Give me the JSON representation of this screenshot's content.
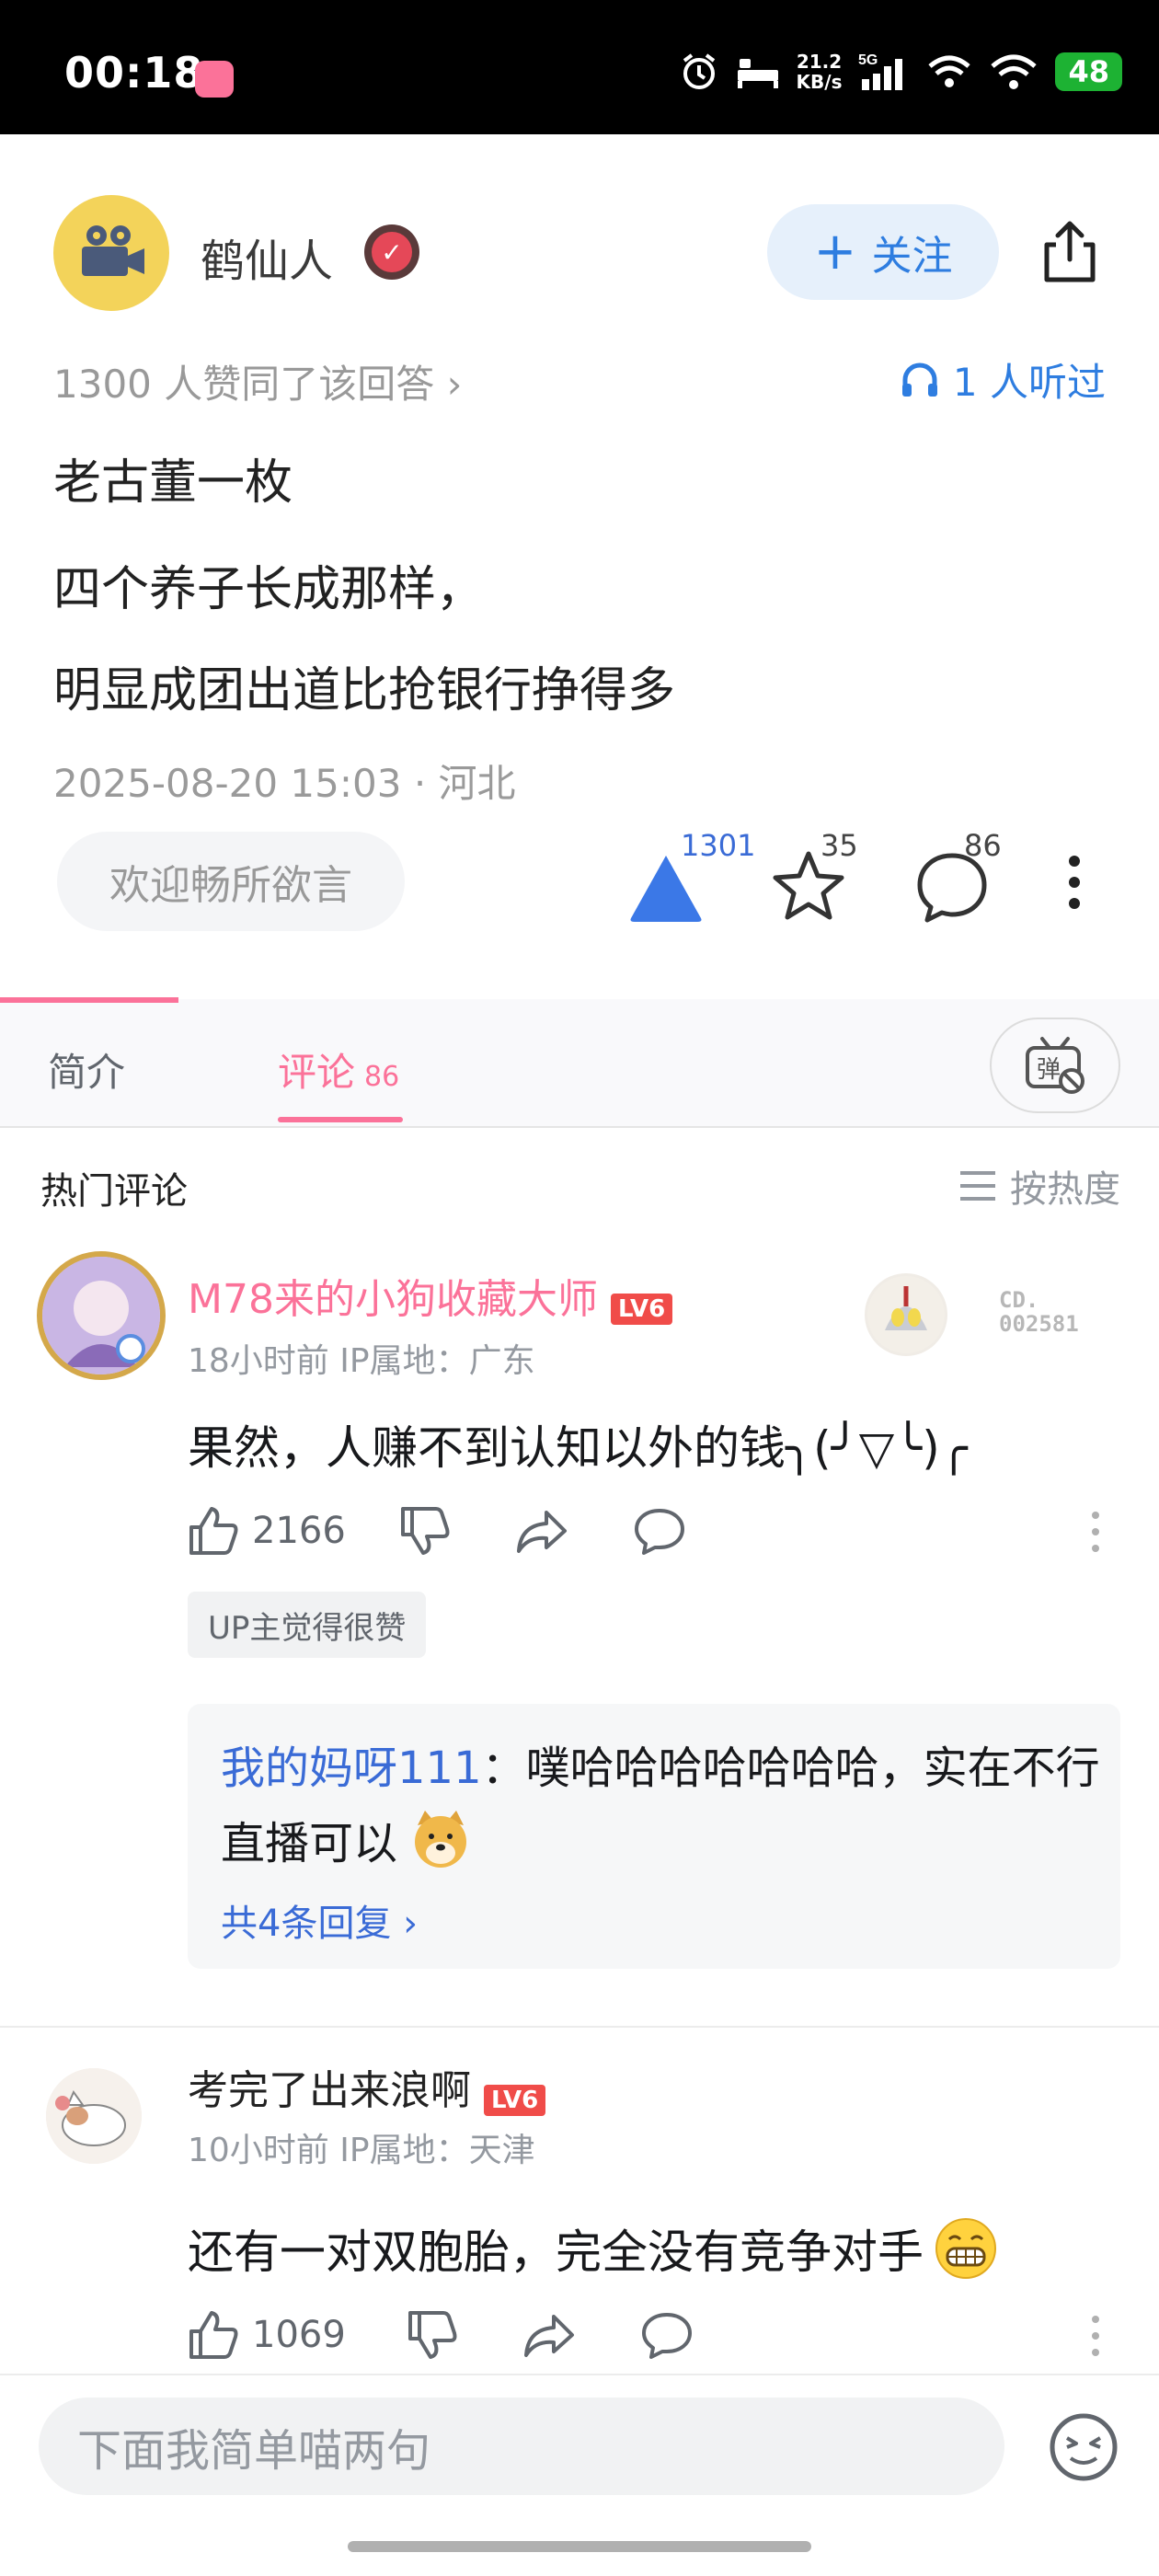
{
  "status_bar": {
    "time": "00:18",
    "net_speed": "21.2",
    "net_unit": "KB/s",
    "network": "5G",
    "battery": "48"
  },
  "answer": {
    "author": "鹤仙人",
    "follow_label": "关注",
    "agree_text": "1300 人赞同了该回答 ›",
    "listened_text": "1 人听过",
    "lines": [
      "老古董一枚",
      "四个养子长成那样，",
      "明显成团出道比抢银行挣得多"
    ],
    "timestamp": "2025-08-20 15:03 · 河北",
    "reply_placeholder": "欢迎畅所欲言",
    "upvotes": "1301",
    "favorites": "35",
    "comment_count": "86"
  },
  "tabs": {
    "intro": "简介",
    "comments": "评论",
    "comments_count": "86"
  },
  "comments": {
    "hot_title": "热门评论",
    "sort_label": "按热度",
    "items": [
      {
        "user": "M78来的小狗收藏大师",
        "level": "LV6",
        "meta": "18小时前 IP属地：广东",
        "text": "果然，人赚不到认知以外的钱╮(╯▽╰)╭",
        "likes": "2166",
        "up_tag": "UP主觉得很赞",
        "badge_text": "CD.\n002581",
        "reply": {
          "user": "我的妈呀111",
          "text_1": "：噗哈哈哈哈哈哈哈，实在不行",
          "text_2": "直播可以",
          "more": "共4条回复 ›"
        }
      },
      {
        "user": "考完了出来浪啊",
        "level": "LV6",
        "meta": "10小时前 IP属地：天津",
        "text": "还有一对双胞胎，完全没有竞争对手",
        "likes": "1069"
      }
    ]
  },
  "bottom": {
    "input_placeholder": "下面我简单喵两句"
  },
  "colors": {
    "accent": "#fb7299",
    "link": "#3a6bd6",
    "follow_bg": "#e6f0fb",
    "upvote": "#3b78e7"
  }
}
